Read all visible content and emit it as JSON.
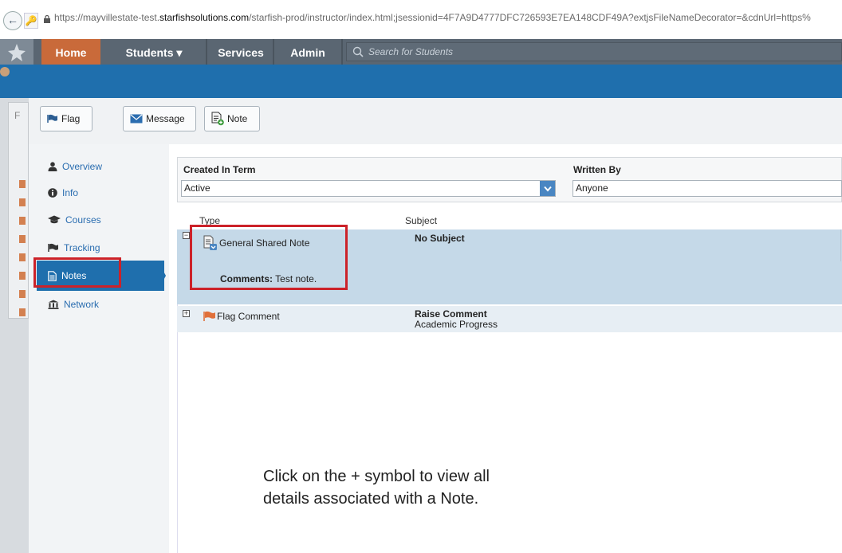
{
  "browser": {
    "url_prefix": "https://mayvillestate-test.",
    "url_host": "starfishsolutions.com",
    "url_suffix": "/starfish-prod/instructor/index.html;jsessionid=4F7A9D4777DFC726593E7EA148CDF49A?extjsFileNameDecorator=&cdnUrl=https%"
  },
  "nav": {
    "tabs": [
      {
        "label": "Home"
      },
      {
        "label": "Students ▾"
      },
      {
        "label": "Services"
      },
      {
        "label": "Admin"
      }
    ],
    "search_placeholder": "Search for Students"
  },
  "left_panel": {
    "letter": "F"
  },
  "toolbar": {
    "flag_label": "Flag",
    "message_label": "Message",
    "note_label": "Note"
  },
  "sidenav": {
    "items": [
      {
        "label": "Overview",
        "icon": "person-icon"
      },
      {
        "label": "Info",
        "icon": "info-icon"
      },
      {
        "label": "Courses",
        "icon": "graduation-cap-icon"
      },
      {
        "label": "Tracking",
        "icon": "flag-icon"
      },
      {
        "label": "Notes",
        "icon": "note-icon",
        "selected": true
      },
      {
        "label": "Network",
        "icon": "building-icon"
      }
    ]
  },
  "filters": {
    "term_label": "Created In Term",
    "term_value": "Active",
    "written_label": "Written By",
    "written_value": "Anyone"
  },
  "grid": {
    "columns": [
      "Type",
      "Subject"
    ],
    "rows": [
      {
        "expander": "⊟",
        "type": "General Shared Note",
        "comments_label": "Comments:",
        "comments_value": "Test note.",
        "subject": "No Subject",
        "subject_detail": ""
      },
      {
        "expander": "⊞",
        "type": "Flag Comment",
        "subject": "Raise Comment",
        "subject_detail": "Academic Progress"
      }
    ]
  },
  "instruction": {
    "line1": "Click on the + symbol to view all",
    "line2": "details associated with a Note."
  },
  "colors": {
    "nav_bg": "#5a6672",
    "home_tab": "#c96a3a",
    "banner": "#1f6fad",
    "highlight_box": "#cc2229",
    "selected_row": "#c5d9e8"
  }
}
